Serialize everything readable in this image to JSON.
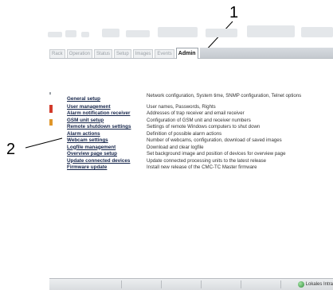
{
  "callouts": {
    "one": "1",
    "two": "2"
  },
  "tabs": [
    "Rack",
    "Operation",
    "Status",
    "Setup",
    "Images",
    "Events",
    "Admin"
  ],
  "active_tab": "Admin",
  "menu": [
    {
      "link": "General setup",
      "desc": "Network configuration, System time, SNMP configuration, Telnet options"
    },
    {
      "link": "User management",
      "desc": "User names, Passwords, Rights"
    },
    {
      "link": "Alarm notification receiver",
      "desc": "Addresses of trap receiver and email receiver"
    },
    {
      "link": "GSM unit setup",
      "desc": "Configuration of GSM unit and receiver numbers"
    },
    {
      "link": "Remote shutdown settings",
      "desc": "Settings of remote Windows computers to shut down"
    },
    {
      "link": "Alarm actions",
      "desc": "Definition of possible alarm actions"
    },
    {
      "link": "Webcam settings",
      "desc": "Number of webcams, configuration, download of saved images"
    },
    {
      "link": "Logfile management",
      "desc": "Download and clear logfile"
    },
    {
      "link": "Overview page setup",
      "desc": "Set background image and position of devices for overview page"
    },
    {
      "link": "Update connected devices",
      "desc": "Update connected processing units to the latest release"
    },
    {
      "link": "Firmware update",
      "desc": "Install new release of the CMC-TC Master firmware"
    }
  ],
  "statusbar": {
    "zone": "Lokales Intra"
  },
  "colors": {
    "link": "#14244a",
    "accent_red": "#d23a2a",
    "accent_orange": "#e0962a",
    "accent_yellow": "#e8c23a"
  }
}
